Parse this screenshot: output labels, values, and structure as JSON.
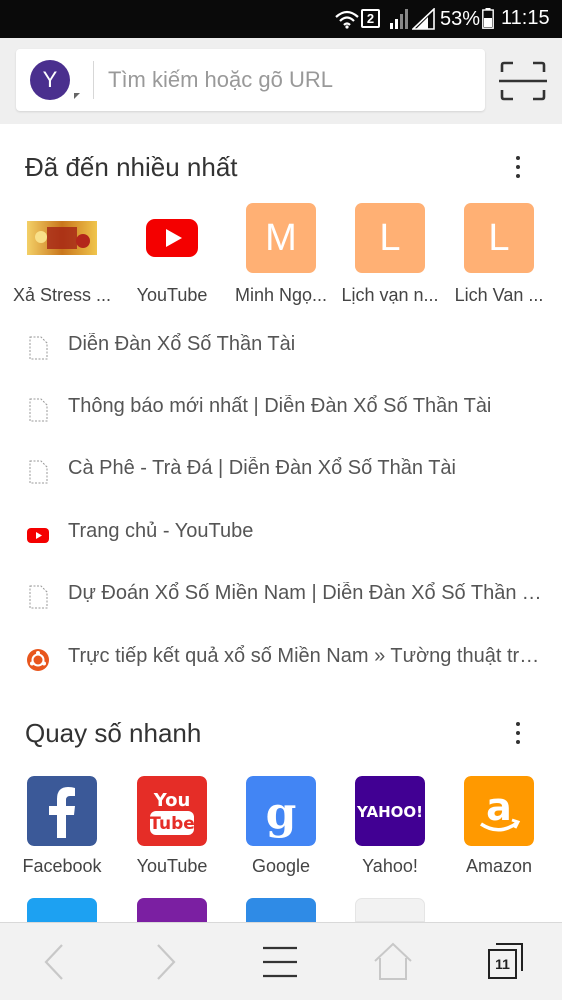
{
  "status_bar": {
    "sim_badge": "2",
    "battery": "53%",
    "time": "11:15"
  },
  "toolbar": {
    "avatar_letter": "Y",
    "search_placeholder": "Tìm kiếm hoặc gõ URL",
    "scan_icon": "qr-scan-icon"
  },
  "most_visited": {
    "title": "Đã đến nhiều nhất",
    "tiles": [
      {
        "label": "Xả Stress ...",
        "icon": "lottery-thumbnail"
      },
      {
        "label": "YouTube",
        "icon": "youtube-icon"
      },
      {
        "label": "Minh Ngọ...",
        "letter": "M",
        "color": "#ffb074"
      },
      {
        "label": "Lịch vạn n...",
        "letter": "L",
        "color": "#ffb074"
      },
      {
        "label": "Lich Van ...",
        "letter": "L",
        "color": "#ffb074"
      }
    ],
    "history": [
      {
        "label": "Diễn Đàn Xổ Số Thần Tài",
        "icon": "page-icon"
      },
      {
        "label": "Thông báo mới nhất | Diễn Đàn Xổ Số Thần Tài",
        "icon": "page-icon"
      },
      {
        "label": "Cà Phê - Trà Đá | Diễn Đàn Xổ Số Thần Tài",
        "icon": "page-icon"
      },
      {
        "label": "Trang chủ - YouTube",
        "icon": "youtube-icon"
      },
      {
        "label": "Dự Đoán Xổ Số Miền Nam | Diễn Đàn Xổ Số Thần Tài",
        "icon": "page-icon"
      },
      {
        "label": "Trực tiếp kết quả xổ số Miền Nam » Tường thuật trực tiếp",
        "icon": "ubuntu-style-icon"
      }
    ]
  },
  "speed_dial": {
    "title": "Quay số nhanh",
    "tiles": [
      {
        "label": "Facebook",
        "icon": "facebook-icon",
        "color": "#3b5998"
      },
      {
        "label": "YouTube",
        "icon": "youtube-icon",
        "color": "#e52d27"
      },
      {
        "label": "Google",
        "icon": "google-icon",
        "color": "#4285f4"
      },
      {
        "label": "Yahoo!",
        "icon": "yahoo-icon",
        "color": "#410093"
      },
      {
        "label": "Amazon",
        "icon": "amazon-icon",
        "color": "#ff9900"
      }
    ]
  },
  "bottom_bar": {
    "tab_count": "11"
  }
}
